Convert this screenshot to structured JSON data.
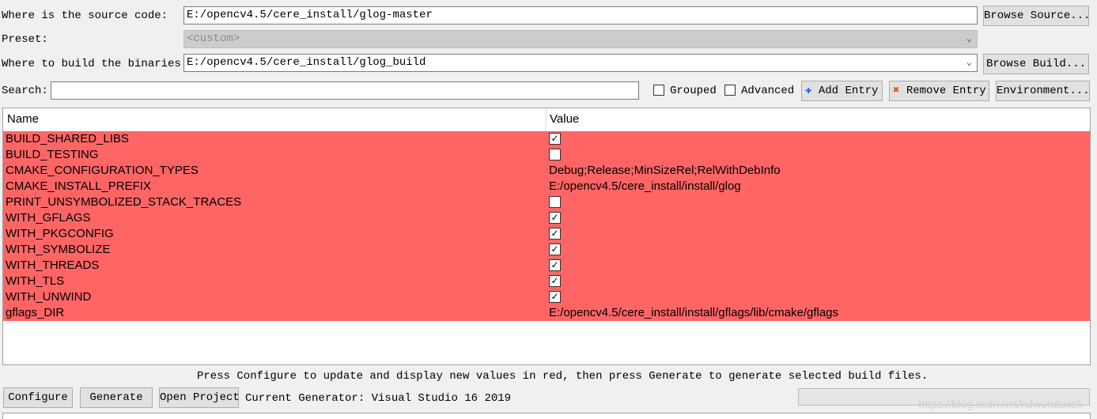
{
  "source": {
    "label": "Where is the source code:",
    "value": "E:/opencv4.5/cere_install/glog-master",
    "browse_label": "Browse Source..."
  },
  "preset": {
    "label": "Preset:",
    "value": "<custom>"
  },
  "build": {
    "label": "Where to build the binaries:",
    "value": "E:/opencv4.5/cere_install/glog_build",
    "browse_label": "Browse Build..."
  },
  "search": {
    "label": "Search:",
    "value": ""
  },
  "options": {
    "grouped": {
      "label": "Grouped",
      "checked": false
    },
    "advanced": {
      "label": "Advanced",
      "checked": false
    }
  },
  "actions": {
    "add_entry": "Add Entry",
    "remove_entry": "Remove Entry",
    "environment": "Environment..."
  },
  "table": {
    "headers": {
      "name": "Name",
      "value": "Value"
    },
    "row_color": "#ff6565",
    "rows": [
      {
        "name": "BUILD_SHARED_LIBS",
        "type": "bool",
        "checked": true,
        "value": ""
      },
      {
        "name": "BUILD_TESTING",
        "type": "bool",
        "checked": false,
        "value": ""
      },
      {
        "name": "CMAKE_CONFIGURATION_TYPES",
        "type": "string",
        "value": "Debug;Release;MinSizeRel;RelWithDebInfo"
      },
      {
        "name": "CMAKE_INSTALL_PREFIX",
        "type": "string",
        "value": "E:/opencv4.5/cere_install/install/glog"
      },
      {
        "name": "PRINT_UNSYMBOLIZED_STACK_TRACES",
        "type": "bool",
        "checked": false,
        "value": ""
      },
      {
        "name": "WITH_GFLAGS",
        "type": "bool",
        "checked": true,
        "value": ""
      },
      {
        "name": "WITH_PKGCONFIG",
        "type": "bool",
        "checked": true,
        "value": ""
      },
      {
        "name": "WITH_SYMBOLIZE",
        "type": "bool",
        "checked": true,
        "value": ""
      },
      {
        "name": "WITH_THREADS",
        "type": "bool",
        "checked": true,
        "value": ""
      },
      {
        "name": "WITH_TLS",
        "type": "bool",
        "checked": true,
        "value": ""
      },
      {
        "name": "WITH_UNWIND",
        "type": "bool",
        "checked": true,
        "value": ""
      },
      {
        "name": "gflags_DIR",
        "type": "string",
        "value": "E:/opencv4.5/cere_install/install/gflags/lib/cmake/gflags"
      }
    ]
  },
  "hint": "Press Configure to update and display new values in red, then press Generate to generate selected build files.",
  "bottom": {
    "configure": "Configure",
    "generate": "Generate",
    "open_project": "Open Project",
    "generator": "Current Generator: Visual Studio 16 2019"
  },
  "watermark": "https://blog.csdn.net/ndwonduosk"
}
